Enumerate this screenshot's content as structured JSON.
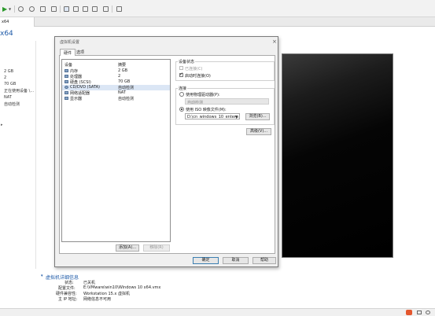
{
  "tab": {
    "label": "x64"
  },
  "vm_title": "x64",
  "specs": [
    "2 GB",
    "2",
    "70 GB",
    "正在使用设备 \\...",
    "NAT",
    "自动检测"
  ],
  "dialog": {
    "title": "虚拟机设置",
    "tabs": [
      "硬件",
      "选项"
    ],
    "columns": {
      "device": "设备",
      "summary": "摘要"
    },
    "devices": [
      {
        "name": "内存",
        "summary": "2 GB",
        "icon": "memory-icon"
      },
      {
        "name": "处理器",
        "summary": "2",
        "icon": "cpu-icon"
      },
      {
        "name": "硬盘 (SCSI)",
        "summary": "70 GB",
        "icon": "disk-icon"
      },
      {
        "name": "CD/DVD (SATA)",
        "summary": "自动检测",
        "icon": "cd-icon"
      },
      {
        "name": "网络适配器",
        "summary": "NAT",
        "icon": "network-icon"
      },
      {
        "name": "显示器",
        "summary": "自动检测",
        "icon": "display-icon"
      }
    ],
    "add_button": "添加(A)...",
    "remove_button": "移除(R)",
    "device_status": {
      "group_label": "设备状态",
      "connected": "已连接(C)",
      "connect_on_power": "启动时连接(O)"
    },
    "connection": {
      "group_label": "连接",
      "physical_drive": "使用物理驱动器(P):",
      "physical_value": "自动检测",
      "iso_image": "使用 ISO 映像文件(M):",
      "iso_path": "D:\\cn_windows_10_enterp",
      "browse_button": "浏览(B)...",
      "advanced_button": "高级(V)..."
    },
    "ok_button": "确定",
    "cancel_button": "取消",
    "help_button": "帮助"
  },
  "details": {
    "header": "虚拟机详细信息",
    "rows": [
      {
        "label": "状态:",
        "value": "已关机"
      },
      {
        "label": "配置文件:",
        "value": "E:\\VMware\\win10\\Windows 10 x64.vmx"
      },
      {
        "label": "硬件兼容性:",
        "value": "Workstation 15.x 虚拟机"
      },
      {
        "label": "主 IP 地址:",
        "value": "网络信息不可用"
      }
    ]
  },
  "colors": {
    "accent": "#1e5aa8",
    "preview_bg": "#000000"
  }
}
